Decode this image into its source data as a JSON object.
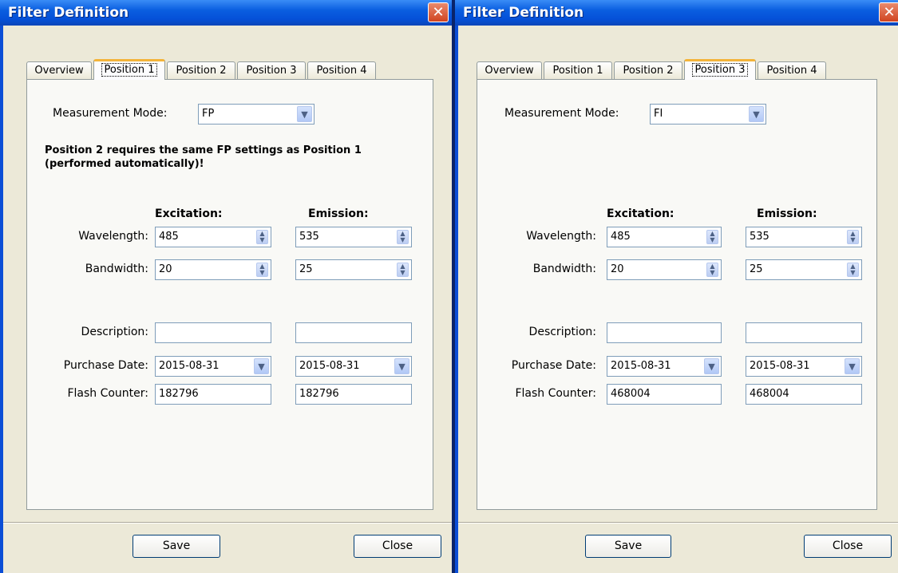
{
  "windows": [
    {
      "title": "Filter Definition",
      "close_glyph": "✕",
      "tabs": [
        "Overview",
        "Position 1",
        "Position 2",
        "Position 3",
        "Position 4"
      ],
      "active_tab": "Position 1",
      "measurement_mode_label": "Measurement Mode:",
      "measurement_mode_value": "FP",
      "note": "Position 2 requires the same FP settings as Position 1 (performed automatically)!",
      "excitation_header": "Excitation:",
      "emission_header": "Emission:",
      "wavelength_label": "Wavelength:",
      "bandwidth_label": "Bandwidth:",
      "description_label": "Description:",
      "purchase_date_label": "Purchase Date:",
      "flash_counter_label": "Flash Counter:",
      "excitation": {
        "wavelength": "485",
        "bandwidth": "20",
        "description": "",
        "purchase_date": "2015-08-31",
        "flash_counter": "182796"
      },
      "emission": {
        "wavelength": "535",
        "bandwidth": "25",
        "description": "",
        "purchase_date": "2015-08-31",
        "flash_counter": "182796"
      },
      "save_label": "Save",
      "close_label": "Close"
    },
    {
      "title": "Filter Definition",
      "close_glyph": "✕",
      "tabs": [
        "Overview",
        "Position 1",
        "Position 2",
        "Position 3",
        "Position 4"
      ],
      "active_tab": "Position 3",
      "measurement_mode_label": "Measurement Mode:",
      "measurement_mode_value": "FI",
      "excitation_header": "Excitation:",
      "emission_header": "Emission:",
      "wavelength_label": "Wavelength:",
      "bandwidth_label": "Bandwidth:",
      "description_label": "Description:",
      "purchase_date_label": "Purchase Date:",
      "flash_counter_label": "Flash Counter:",
      "excitation": {
        "wavelength": "485",
        "bandwidth": "20",
        "description": "",
        "purchase_date": "2015-08-31",
        "flash_counter": "468004"
      },
      "emission": {
        "wavelength": "535",
        "bandwidth": "25",
        "description": "",
        "purchase_date": "2015-08-31",
        "flash_counter": "468004"
      },
      "save_label": "Save",
      "close_label": "Close"
    }
  ],
  "colors": {
    "titlebar": "#0a5ee0",
    "close_button": "#d04420",
    "window_bg": "#ece9d8",
    "active_tab_accent": "#f3b43a"
  }
}
